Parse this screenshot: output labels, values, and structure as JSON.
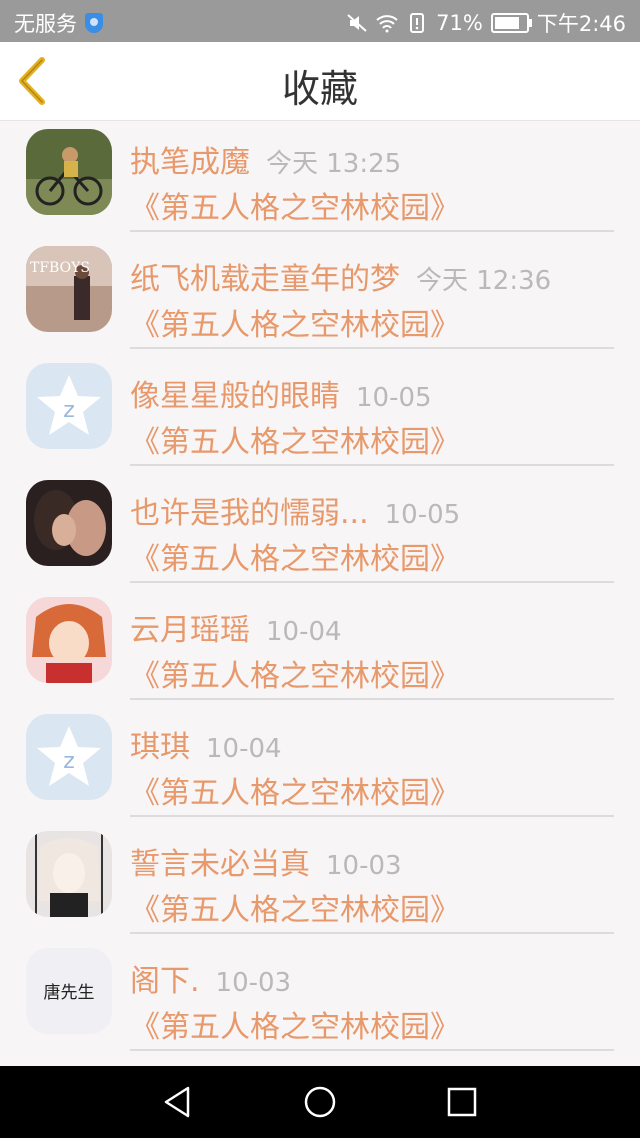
{
  "status_bar": {
    "carrier": "无服务",
    "battery": "71%",
    "time": "下午2:46"
  },
  "header": {
    "title": "收藏"
  },
  "items": [
    {
      "name": "执笔成魔",
      "time": "今天 13:25",
      "work": "《第五人格之空林校园》",
      "avatar": "photo-bike"
    },
    {
      "name": "纸飞机载走童年的梦",
      "time": "今天 12:36",
      "work": "《第五人格之空林校园》",
      "avatar": "photo-tfboys"
    },
    {
      "name": "像星星般的眼睛",
      "time": "10-05",
      "work": "《第五人格之空林校园》",
      "avatar": "qq-default"
    },
    {
      "name": "也许是我的懦弱...",
      "time": "10-05",
      "work": "《第五人格之空林校园》",
      "avatar": "photo-kiss"
    },
    {
      "name": "云月瑶瑶",
      "time": "10-04",
      "work": "《第五人格之空林校园》",
      "avatar": "anime-girl-red"
    },
    {
      "name": "琪琪",
      "time": "10-04",
      "work": "《第五人格之空林校园》",
      "avatar": "qq-default"
    },
    {
      "name": "誓言未必当真",
      "time": "10-03",
      "work": "《第五人格之空林校园》",
      "avatar": "anime-girl-dark"
    },
    {
      "name": "阁下.",
      "time": "10-03",
      "work": "《第五人格之空林校园》",
      "avatar": "text-avatar",
      "avatar_text": "唐先生"
    }
  ],
  "colors": {
    "accent": "#e8996b",
    "time": "#b9b9b9",
    "back_icon": "#e5b020"
  }
}
